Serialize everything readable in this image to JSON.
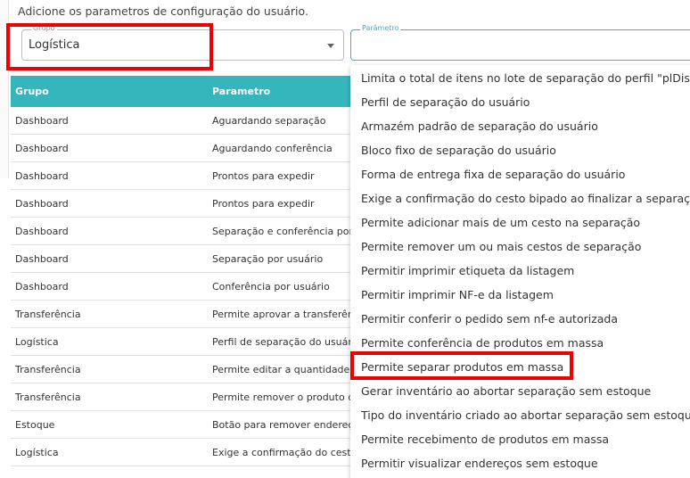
{
  "subtitle": "Adicione os parametros de configuração do usuário.",
  "grupo_field": {
    "legend": "Grupo",
    "value": "Logística"
  },
  "param_field": {
    "legend": "Parâmetro",
    "value": ""
  },
  "table": {
    "headers": {
      "grupo": "Grupo",
      "param": "Parametro"
    },
    "rows": [
      {
        "grupo": "Dashboard",
        "param": "Aguardando separação"
      },
      {
        "grupo": "Dashboard",
        "param": "Aguardando conferência"
      },
      {
        "grupo": "Dashboard",
        "param": "Prontos para expedir"
      },
      {
        "grupo": "Dashboard",
        "param": "Prontos para expedir"
      },
      {
        "grupo": "Dashboard",
        "param": "Separação e conferência por lote"
      },
      {
        "grupo": "Dashboard",
        "param": "Separação por usuário"
      },
      {
        "grupo": "Dashboard",
        "param": "Conferência por usuário"
      },
      {
        "grupo": "Transferência",
        "param": "Permite aprovar a transferência"
      },
      {
        "grupo": "Logística",
        "param": "Perfil de separação do usuário"
      },
      {
        "grupo": "Transferência",
        "param": "Permite editar a quantidade"
      },
      {
        "grupo": "Transferência",
        "param": "Permite remover o produto da"
      },
      {
        "grupo": "Estoque",
        "param": "Botão para remover endereço"
      },
      {
        "grupo": "Logística",
        "param": "Exige a confirmação do cesto"
      }
    ]
  },
  "dropdown": {
    "options": [
      "Limita o total de itens no lote de separação do perfil \"plDiscret",
      "Perfil de separação do usuário",
      "Armazém padrão de separação do usuário",
      "Bloco fixo de separação do usuário",
      "Forma de entrega fixa de separação do usuário",
      "Exige a confirmação do cesto bipado ao finalizar a separação",
      "Permite adicionar mais de um cesto na separação",
      "Permite remover um ou mais cestos de separação",
      "Permitir imprimir etiqueta da listagem",
      "Permitir imprimir NF-e da listagem",
      "Permitir conferir o pedido sem nf-e autorizada",
      "Permite conferência de produtos em massa",
      "Permite separar produtos em massa",
      "Gerar inventário ao abortar separação sem estoque",
      "Tipo do inventário criado ao abortar separação sem estoque",
      "Permite recebimento de produtos em massa",
      "Permitir visualizar endereços sem estoque"
    ]
  },
  "colors": {
    "header_teal": "#35b6bd",
    "highlight_red": "#ee0000",
    "focus_blue": "#4aa9c4"
  }
}
